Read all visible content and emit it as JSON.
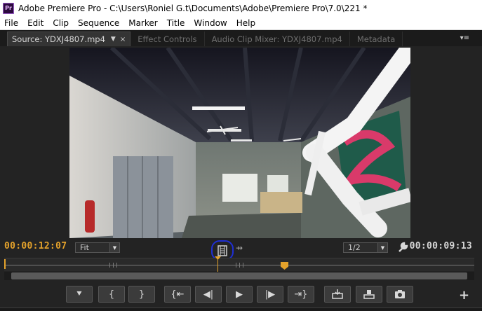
{
  "window": {
    "title": "Adobe Premiere Pro - C:\\Users\\Roniel G.t\\Documents\\Adobe\\Premiere Pro\\7.0\\221 *",
    "app_icon_text": "Pr"
  },
  "menu": [
    "File",
    "Edit",
    "Clip",
    "Sequence",
    "Marker",
    "Title",
    "Window",
    "Help"
  ],
  "tabs": {
    "active": "Source: YDXJ4807.mp4",
    "others": [
      "Effect Controls",
      "Audio Clip Mixer: YDXJ4807.mp4",
      "Metadata"
    ]
  },
  "monitor": {
    "current_timecode": "00:00:12:07",
    "duration_timecode": "00:00:09:13",
    "zoom_value": "Fit",
    "resolution_value": "1/2"
  },
  "transport_icons": [
    "add-marker-icon",
    "mark-in-icon",
    "mark-out-icon",
    "go-to-in-icon",
    "step-back-icon",
    "play-icon",
    "step-forward-icon",
    "go-to-out-icon",
    "insert-icon",
    "overwrite-icon",
    "export-frame-icon"
  ],
  "colors": {
    "timecode_accent": "#e4a22b",
    "highlight_circle": "#1f2fd4"
  }
}
